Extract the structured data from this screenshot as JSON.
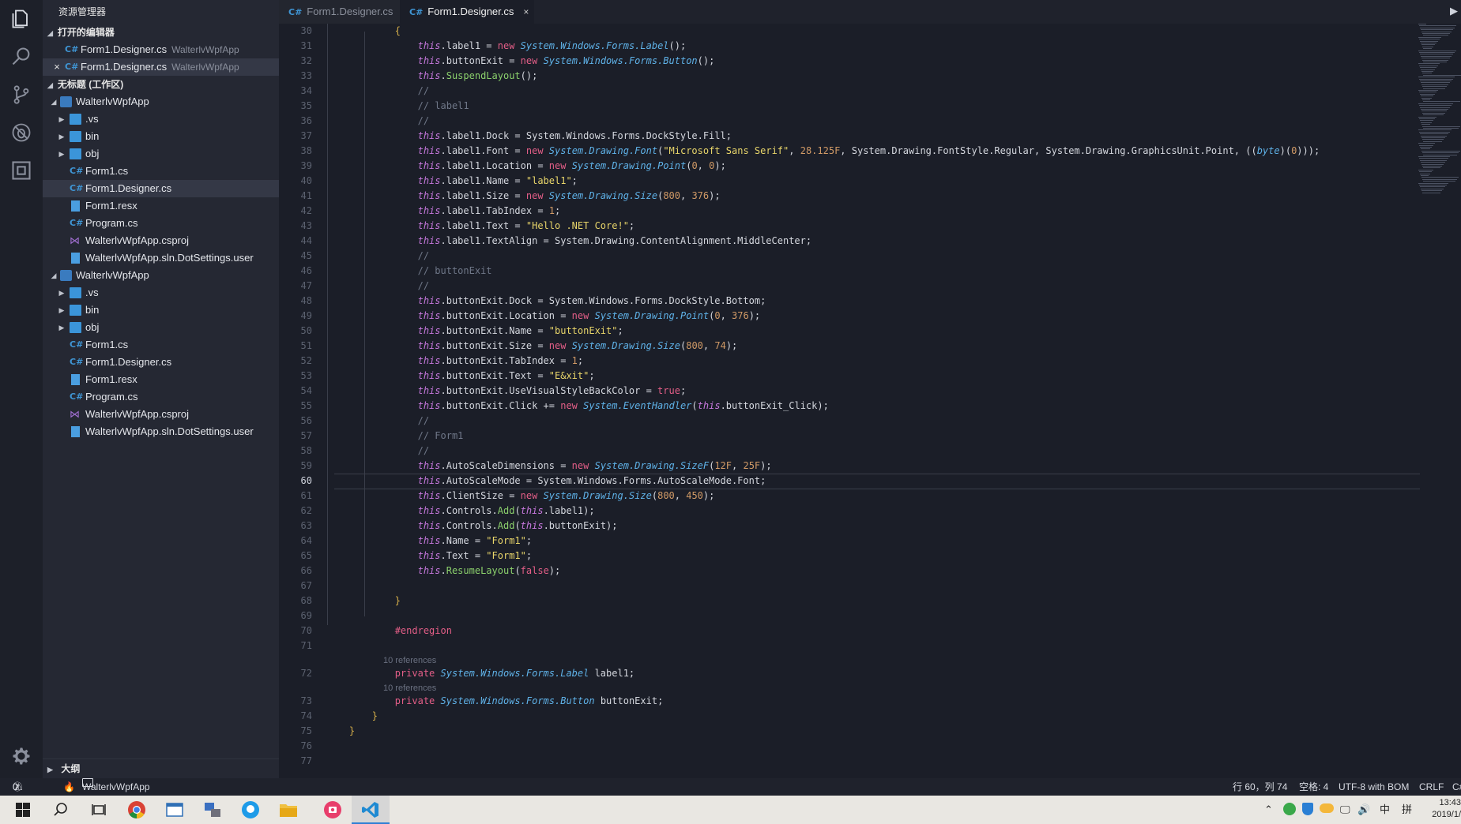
{
  "sidebar": {
    "title": "资源管理器",
    "open_editors": {
      "header": "打开的编辑器",
      "items": [
        {
          "name": "Form1.Designer.cs",
          "desc": "WalterlvWpfApp",
          "close": ""
        },
        {
          "name": "Form1.Designer.cs",
          "desc": "WalterlvWpfApp",
          "close": "×"
        }
      ]
    },
    "workspace": {
      "header": "无标题 (工作区)",
      "projects": [
        {
          "name": "WalterlvWpfApp",
          "items": [
            ".vs",
            "bin",
            "obj",
            "Form1.cs",
            "Form1.Designer.cs",
            "Form1.resx",
            "Program.cs",
            "WalterlvWpfApp.csproj",
            "WalterlvWpfApp.sln.DotSettings.user"
          ]
        },
        {
          "name": "WalterlvWpfApp",
          "items": [
            ".vs",
            "bin",
            "obj",
            "Form1.cs",
            "Form1.Designer.cs",
            "Form1.resx",
            "Program.cs",
            "WalterlvWpfApp.csproj",
            "WalterlvWpfApp.sln.DotSettings.user"
          ]
        }
      ]
    },
    "outline": "大纲"
  },
  "tabs": [
    {
      "label": "Form1.Designer.cs",
      "icon": "C#",
      "close": ""
    },
    {
      "label": "Form1.Designer.cs",
      "icon": "C#",
      "close": "×"
    }
  ],
  "editor": {
    "current_line": "60",
    "lines": [
      {
        "n": "30",
        "t": "            {"
      },
      {
        "n": "31",
        "t": "                this.label1 = new System.Windows.Forms.Label();"
      },
      {
        "n": "32",
        "t": "                this.buttonExit = new System.Windows.Forms.Button();"
      },
      {
        "n": "33",
        "t": "                this.SuspendLayout();"
      },
      {
        "n": "34",
        "t": "                //"
      },
      {
        "n": "35",
        "t": "                // label1"
      },
      {
        "n": "36",
        "t": "                //"
      },
      {
        "n": "37",
        "t": "                this.label1.Dock = System.Windows.Forms.DockStyle.Fill;"
      },
      {
        "n": "38",
        "t": "                this.label1.Font = new System.Drawing.Font(\"Microsoft Sans Serif\", 28.125F, System.Drawing.FontStyle.Regular, System.Drawing.GraphicsUnit.Point, ((byte)(0)));"
      },
      {
        "n": "39",
        "t": "                this.label1.Location = new System.Drawing.Point(0, 0);"
      },
      {
        "n": "40",
        "t": "                this.label1.Name = \"label1\";"
      },
      {
        "n": "41",
        "t": "                this.label1.Size = new System.Drawing.Size(800, 376);"
      },
      {
        "n": "42",
        "t": "                this.label1.TabIndex = 1;"
      },
      {
        "n": "43",
        "t": "                this.label1.Text = \"Hello .NET Core!\";"
      },
      {
        "n": "44",
        "t": "                this.label1.TextAlign = System.Drawing.ContentAlignment.MiddleCenter;"
      },
      {
        "n": "45",
        "t": "                //"
      },
      {
        "n": "46",
        "t": "                // buttonExit"
      },
      {
        "n": "47",
        "t": "                //"
      },
      {
        "n": "48",
        "t": "                this.buttonExit.Dock = System.Windows.Forms.DockStyle.Bottom;"
      },
      {
        "n": "49",
        "t": "                this.buttonExit.Location = new System.Drawing.Point(0, 376);"
      },
      {
        "n": "50",
        "t": "                this.buttonExit.Name = \"buttonExit\";"
      },
      {
        "n": "51",
        "t": "                this.buttonExit.Size = new System.Drawing.Size(800, 74);"
      },
      {
        "n": "52",
        "t": "                this.buttonExit.TabIndex = 1;"
      },
      {
        "n": "53",
        "t": "                this.buttonExit.Text = \"E&xit\";"
      },
      {
        "n": "54",
        "t": "                this.buttonExit.UseVisualStyleBackColor = true;"
      },
      {
        "n": "55",
        "t": "                this.buttonExit.Click += new System.EventHandler(this.buttonExit_Click);"
      },
      {
        "n": "56",
        "t": "                //"
      },
      {
        "n": "57",
        "t": "                // Form1"
      },
      {
        "n": "58",
        "t": "                //"
      },
      {
        "n": "59",
        "t": "                this.AutoScaleDimensions = new System.Drawing.SizeF(12F, 25F);"
      },
      {
        "n": "60",
        "t": "                this.AutoScaleMode = System.Windows.Forms.AutoScaleMode.Font;"
      },
      {
        "n": "61",
        "t": "                this.ClientSize = new System.Drawing.Size(800, 450);"
      },
      {
        "n": "62",
        "t": "                this.Controls.Add(this.label1);"
      },
      {
        "n": "63",
        "t": "                this.Controls.Add(this.buttonExit);"
      },
      {
        "n": "64",
        "t": "                this.Name = \"Form1\";"
      },
      {
        "n": "65",
        "t": "                this.Text = \"Form1\";"
      },
      {
        "n": "66",
        "t": "                this.ResumeLayout(false);"
      },
      {
        "n": "67",
        "t": ""
      },
      {
        "n": "68",
        "t": "            }"
      },
      {
        "n": "69",
        "t": ""
      },
      {
        "n": "70",
        "t": "            #endregion"
      },
      {
        "n": "71",
        "t": ""
      },
      {
        "lens": "10 references"
      },
      {
        "n": "72",
        "t": "            private System.Windows.Forms.Label label1;"
      },
      {
        "lens": "10 references"
      },
      {
        "n": "73",
        "t": "            private System.Windows.Forms.Button buttonExit;"
      },
      {
        "n": "74",
        "t": "        }"
      },
      {
        "n": "75",
        "t": "    }"
      },
      {
        "n": "76",
        "t": ""
      },
      {
        "n": "77",
        "t": ""
      }
    ]
  },
  "status": {
    "errors": "0",
    "warnings": "0",
    "folder": "WalterlvWpfApp",
    "position": "行 60，列 74",
    "spaces": "空格: 4",
    "encoding": "UTF-8 with BOM",
    "eol": "CRLF",
    "language": "C#"
  },
  "taskbar": {
    "ime": "中",
    "layout": "拼",
    "time": "13:43",
    "date": "2019/1/"
  },
  "colors": {
    "editor_bg": "#1b1e28",
    "sidebar_bg": "#252833",
    "accent_keyword": "#e35e87",
    "accent_this": "#c678dd",
    "accent_type": "#5fb2e8",
    "accent_func": "#8bd06c",
    "accent_string": "#e8d56a"
  }
}
